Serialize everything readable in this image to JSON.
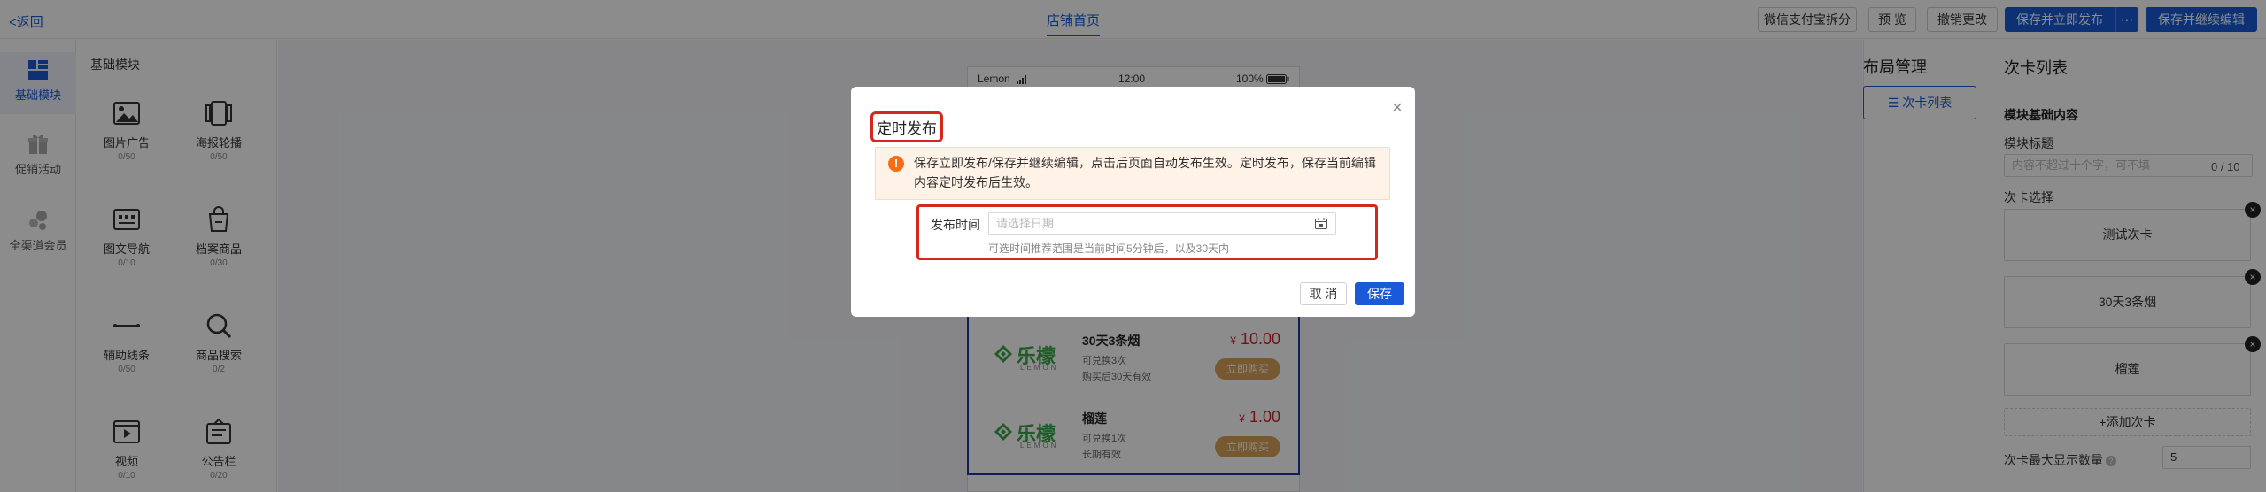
{
  "topbar": {
    "back_label": "<返回",
    "center_tab": "店铺首页",
    "buttons": {
      "wechat_split": "微信支付宝拆分",
      "preview": "预 览",
      "undo": "撤销更改",
      "save_publish": "保存并立即发布",
      "more": "···",
      "save_continue": "保存并继续编辑"
    }
  },
  "leftnav": {
    "items": [
      {
        "label": "基础模块"
      },
      {
        "label": "促销活动"
      },
      {
        "label": "全渠道会员"
      }
    ]
  },
  "modules": {
    "title": "基础模块",
    "items": [
      {
        "label": "图片广告",
        "count": "0/50"
      },
      {
        "label": "海报轮播",
        "count": "0/50"
      },
      {
        "label": "图文导航",
        "count": "0/10"
      },
      {
        "label": "档案商品",
        "count": "0/30"
      },
      {
        "label": "辅助线条",
        "count": "0/50"
      },
      {
        "label": "商品搜索",
        "count": "0/2"
      },
      {
        "label": "视频",
        "count": "0/10"
      },
      {
        "label": "公告栏",
        "count": "0/20"
      }
    ]
  },
  "phone": {
    "carrier": "Lemon",
    "time": "12:00",
    "battery": "100%",
    "cards": [
      {
        "name": "30天3条烟",
        "sub1": "可兑换3次",
        "sub2": "购买后30天有效",
        "price_symbol": "¥",
        "price": "10.00",
        "buy": "立即购买",
        "logo_cn": "乐檬",
        "logo_en": "LEMON"
      },
      {
        "name": "榴莲",
        "sub1": "可兑换1次",
        "sub2": "长期有效",
        "price_symbol": "¥",
        "price": "1.00",
        "buy": "立即购买",
        "logo_cn": "乐檬",
        "logo_en": "LEMON"
      }
    ]
  },
  "layout_manage": {
    "title": "布局管理",
    "button": "次卡列表"
  },
  "right_panel": {
    "title": "次卡列表",
    "section": "模块基础内容",
    "module_title_label": "模块标题",
    "module_title_placeholder": "内容不超过十个字，可不填",
    "module_title_count": "0 / 10",
    "card_select_label": "次卡选择",
    "cards": [
      "测试次卡",
      "30天3条烟",
      "榴莲"
    ],
    "remove_glyph": "×",
    "add_card": "+添加次卡",
    "max_label": "次卡最大显示数量",
    "max_help": "?",
    "max_value": "5"
  },
  "dialog": {
    "title": "定时发布",
    "close": "×",
    "alert_icon": "!",
    "alert_text": "保存立即发布/保存并继续编辑，点击后页面自动发布生效。定时发布，保存当前编辑内容定时发布后生效。",
    "time_label": "发布时间",
    "time_placeholder": "请选择日期",
    "time_hint": "可选时间推荐范围是当前时间5分钟后，以及30天内",
    "cancel": "取 消",
    "save": "保存"
  }
}
